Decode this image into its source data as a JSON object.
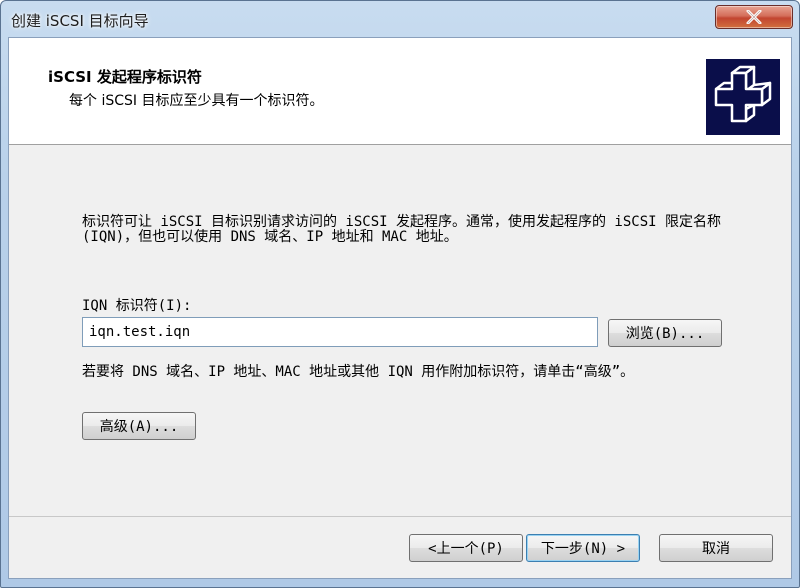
{
  "window": {
    "title": "创建 iSCSI 目标向导"
  },
  "header": {
    "title": "iSCSI 发起程序标识符",
    "subtitle": "每个 iSCSI 目标应至少具有一个标识符。",
    "icon": "wizard-cross-icon"
  },
  "body": {
    "description": "标识符可让 iSCSI 目标识别请求访问的 iSCSI 发起程序。通常，使用发起程序的 iSCSI 限定名称(IQN)，但也可以使用 DNS 域名、IP 地址和 MAC 地址。",
    "iqn_label": "IQN 标识符(I):",
    "iqn_value": "iqn.test.iqn",
    "browse_label": "浏览(B)...",
    "hint": "若要将 DNS 域名、IP 地址、MAC 地址或其他 IQN 用作附加标识符，请单击“高级”。",
    "advanced_label": "高级(A)..."
  },
  "footer": {
    "back_label": "<上一个(P)",
    "next_label": "下一步(N) >",
    "cancel_label": "取消"
  },
  "colors": {
    "title_bar": "#b9d1ea",
    "close_button": "#c24530",
    "header_icon_bg": "#0a0e4a",
    "default_button_border": "#3c7fb1"
  }
}
